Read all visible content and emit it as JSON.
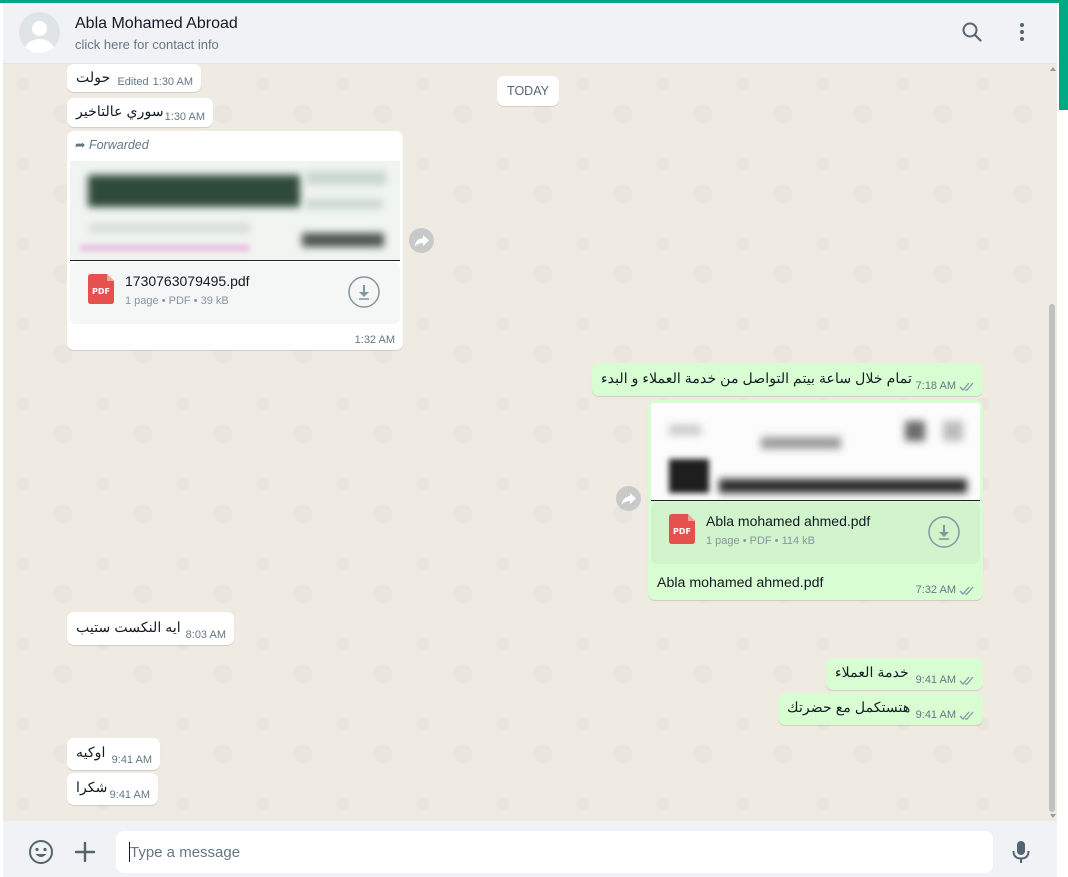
{
  "header": {
    "contact_name": "Abla Mohamed Abroad",
    "contact_sub": "click here for contact info",
    "icons": [
      "search-icon",
      "menu-icon"
    ]
  },
  "day_separator": "TODAY",
  "messages": [
    {
      "dir": "in",
      "text": "حولت",
      "edited": "Edited",
      "time": "1:30 AM"
    },
    {
      "dir": "in",
      "text": "سوري عالتاخير",
      "time": "1:30 AM"
    },
    {
      "dir": "in",
      "forwarded": "Forwarded",
      "doc_name": "1730763079495.pdf",
      "doc_info": "1 page • PDF • 39 kB",
      "time": "1:32 AM"
    },
    {
      "dir": "out",
      "text": "تمام خلال ساعة بيتم التواصل من خدمة العملاء و البدء",
      "time": "7:18 AM",
      "status": "read"
    },
    {
      "dir": "out",
      "doc_name": "Abla mohamed ahmed.pdf",
      "doc_info": "1 page • PDF • 114 kB",
      "caption": "Abla mohamed ahmed.pdf",
      "time": "7:32 AM",
      "status": "read"
    },
    {
      "dir": "in",
      "text": "ايه النكست ستيب",
      "time": "8:03 AM"
    },
    {
      "dir": "out",
      "text": "خدمة العملاء",
      "time": "9:41 AM",
      "status": "read"
    },
    {
      "dir": "out",
      "text": "هتستكمل مع حضرتك",
      "time": "9:41 AM",
      "status": "read"
    },
    {
      "dir": "in",
      "text": "اوكيه",
      "time": "9:41 AM"
    },
    {
      "dir": "in",
      "text": "شكرا",
      "time": "9:41 AM"
    }
  ],
  "pdf_badge": "PDF",
  "composer": {
    "placeholder": "Type a message",
    "icons": [
      "emoji-icon",
      "plus-icon",
      "microphone-icon"
    ]
  },
  "colors": {
    "accent": "#00a884",
    "incoming_bubble": "#ffffff",
    "outgoing_bubble": "#d9fdd3",
    "chat_background": "#efeae2",
    "pdf_red": "#e5524d"
  }
}
